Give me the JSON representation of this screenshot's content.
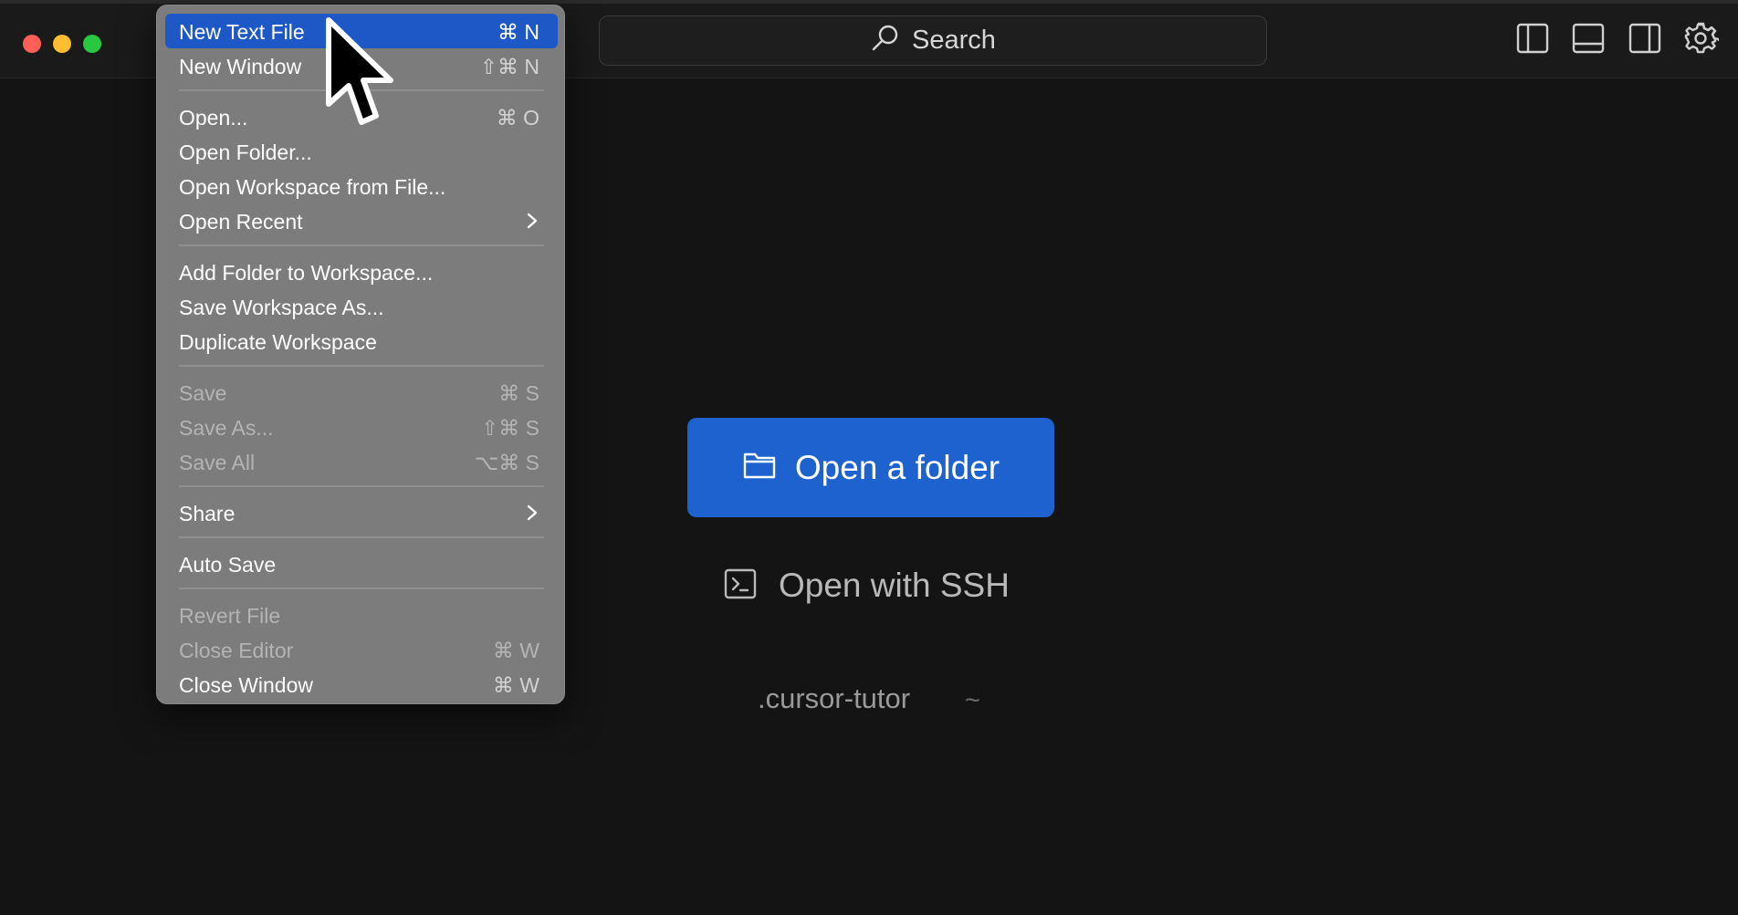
{
  "search": {
    "label": "Search"
  },
  "menu": {
    "items": [
      {
        "label": "New Text File",
        "shortcut": "⌘ N"
      },
      {
        "label": "New Window",
        "shortcut": "⇧⌘ N"
      },
      {
        "label": "Open...",
        "shortcut": "⌘ O"
      },
      {
        "label": "Open Folder...",
        "shortcut": ""
      },
      {
        "label": "Open Workspace from File...",
        "shortcut": ""
      },
      {
        "label": "Open Recent",
        "shortcut": ""
      },
      {
        "label": "Add Folder to Workspace...",
        "shortcut": ""
      },
      {
        "label": "Save Workspace As...",
        "shortcut": ""
      },
      {
        "label": "Duplicate Workspace",
        "shortcut": ""
      },
      {
        "label": "Save",
        "shortcut": "⌘ S"
      },
      {
        "label": "Save As...",
        "shortcut": "⇧⌘ S"
      },
      {
        "label": "Save All",
        "shortcut": "⌥⌘ S"
      },
      {
        "label": "Share",
        "shortcut": ""
      },
      {
        "label": "Auto Save",
        "shortcut": ""
      },
      {
        "label": "Revert File",
        "shortcut": ""
      },
      {
        "label": "Close Editor",
        "shortcut": "⌘ W"
      },
      {
        "label": "Close Window",
        "shortcut": "⌘ W"
      }
    ]
  },
  "main": {
    "open_folder_label": "Open a folder",
    "open_ssh_label": "Open with SSH",
    "recent_name": ".cursor-tutor",
    "recent_path": "~"
  },
  "colors": {
    "accent": "#1e62cf",
    "menu_highlight": "#1d58c6",
    "background": "#141414",
    "menu_background": "#7c7c7c"
  }
}
